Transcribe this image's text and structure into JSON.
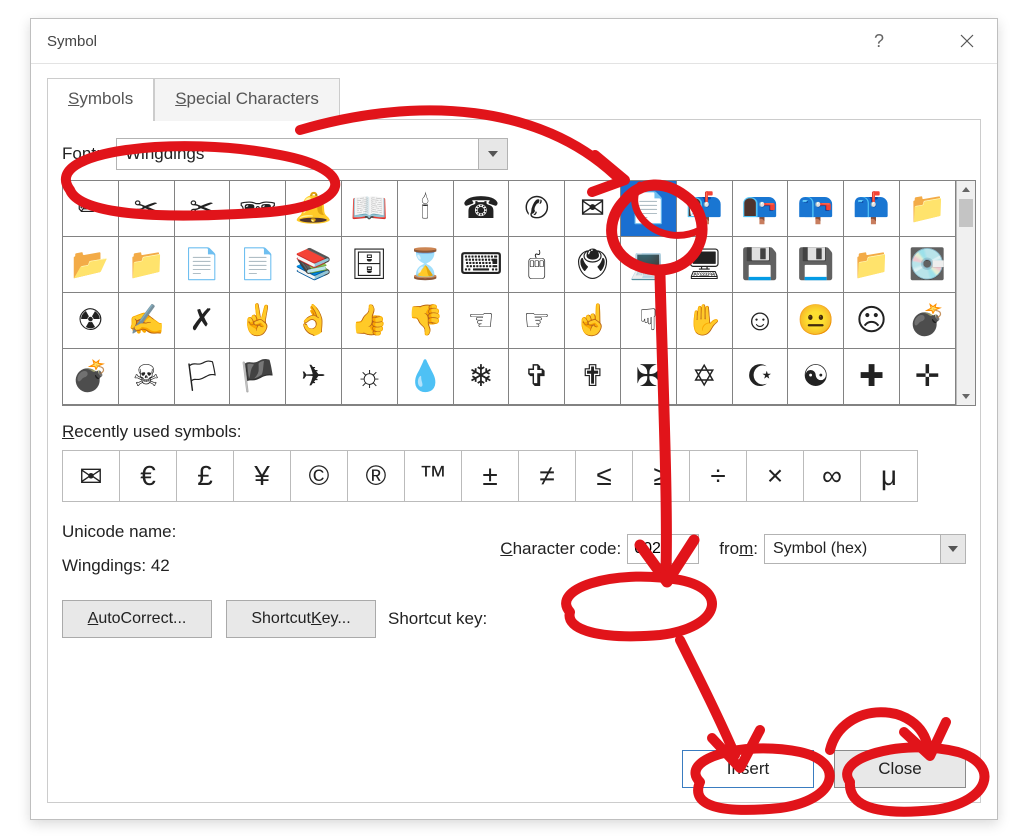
{
  "window": {
    "title": "Symbol"
  },
  "tabs": {
    "symbols": "Symbols",
    "special": "Special Characters"
  },
  "font": {
    "label": "Font:",
    "value": "Wingdings"
  },
  "grid": [
    [
      "✏",
      "✂",
      "✂",
      "🕶",
      "🔔",
      "📖",
      "🕯",
      "☎",
      "✆",
      "✉",
      "📄",
      "📬",
      "📭",
      "📪",
      "📫",
      "📁"
    ],
    [
      "📂",
      "📁",
      "📄",
      "📄",
      "📚",
      "🗄",
      "⌛",
      "⌨",
      "🖱",
      "🖲",
      "💻",
      "🖥",
      "💾",
      "💾",
      "📁",
      "💽"
    ],
    [
      "☢",
      "✍",
      "✗",
      "✌",
      "👌",
      "👍",
      "👎",
      "☜",
      "☞",
      "☝",
      "☟",
      "✋",
      "☺",
      "😐",
      "☹",
      "💣"
    ],
    [
      "💣",
      "☠",
      "🏳",
      "🏴",
      "✈",
      "☼",
      "💧",
      "❄",
      "✞",
      "✟",
      "✠",
      "✡",
      "☪",
      "☯",
      "✚",
      "✛"
    ]
  ],
  "grid_selected": {
    "row": 0,
    "col": 10
  },
  "recent": {
    "label": "Recently used symbols:",
    "items": [
      "✉",
      "€",
      "£",
      "¥",
      "©",
      "®",
      "™",
      "±",
      "≠",
      "≤",
      "≥",
      "÷",
      "×",
      "∞",
      "μ"
    ]
  },
  "unicode": {
    "label": "Unicode name:",
    "value": "Wingdings: 42"
  },
  "char_code": {
    "label": "Character code:",
    "value": "002A"
  },
  "from": {
    "label": "from:",
    "value": "Symbol (hex)"
  },
  "buttons": {
    "autocorrect": "AutoCorrect...",
    "shortcut_key": "Shortcut Key...",
    "shortcut_label": "Shortcut key:",
    "insert": "Insert",
    "close": "Close"
  }
}
